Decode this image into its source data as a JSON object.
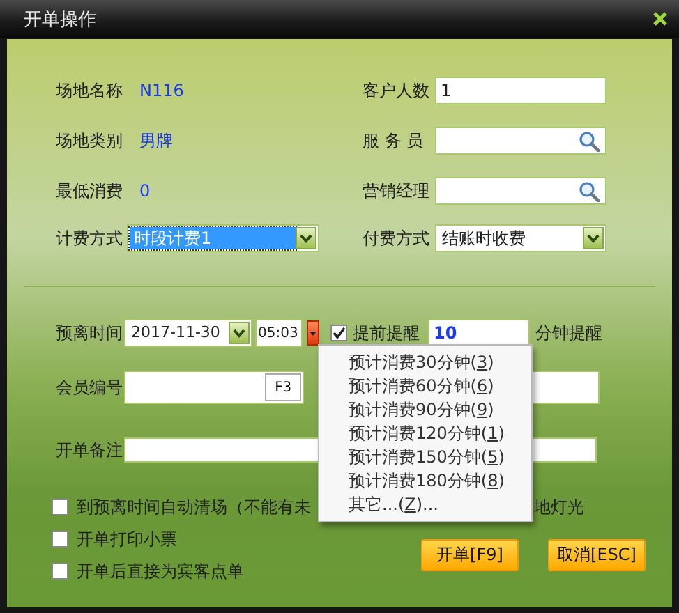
{
  "window": {
    "title": "开单操作"
  },
  "info": [
    {
      "label": "场地名称",
      "value": "N116"
    },
    {
      "label": "场地类别",
      "value": "男牌"
    },
    {
      "label": "最低消费",
      "value": "0"
    }
  ],
  "right_fields": [
    {
      "label": "客户人数",
      "value": "1",
      "kind": "text"
    },
    {
      "label": "服 务 员",
      "kind": "search"
    },
    {
      "label": "营销经理",
      "kind": "search"
    }
  ],
  "billing": {
    "label": "计费方式",
    "value": "时段计费1",
    "highlighted": true
  },
  "payment": {
    "label": "付费方式",
    "value": "结账时收费",
    "highlighted": false
  },
  "departure": {
    "label": "预离时间",
    "date": "2017-11-30",
    "time": "05:03",
    "remind": {
      "label": "提前提醒",
      "checked": true,
      "value": "10",
      "unit": "分钟提醒"
    }
  },
  "member": {
    "label": "会员编号",
    "key": "F3"
  },
  "note": {
    "label": "开单备注"
  },
  "options": [
    {
      "label": "到预离时间自动清场（不能有未",
      "checked": false
    },
    {
      "label": "开单打印小票",
      "checked": false
    },
    {
      "label": "开单后直接为宾客点单",
      "checked": false
    }
  ],
  "option_tail": "地灯光",
  "buttons": [
    {
      "label": "开单[F9]"
    },
    {
      "label": "取消[ESC]"
    }
  ],
  "menu": [
    {
      "text": "预计消费30分钟(",
      "mnemonic": "3",
      "after": ")"
    },
    {
      "text": "预计消费60分钟(",
      "mnemonic": "6",
      "after": ")"
    },
    {
      "text": "预计消费90分钟(",
      "mnemonic": "9",
      "after": ")"
    },
    {
      "text": "预计消费120分钟(",
      "mnemonic": "1",
      "after": ")"
    },
    {
      "text": "预计消费150分钟(",
      "mnemonic": "5",
      "after": ")"
    },
    {
      "text": "预计消费180分钟(",
      "mnemonic": "8",
      "after": ")"
    },
    {
      "text": "其它...(",
      "mnemonic": "Z",
      "after": ")..."
    }
  ]
}
